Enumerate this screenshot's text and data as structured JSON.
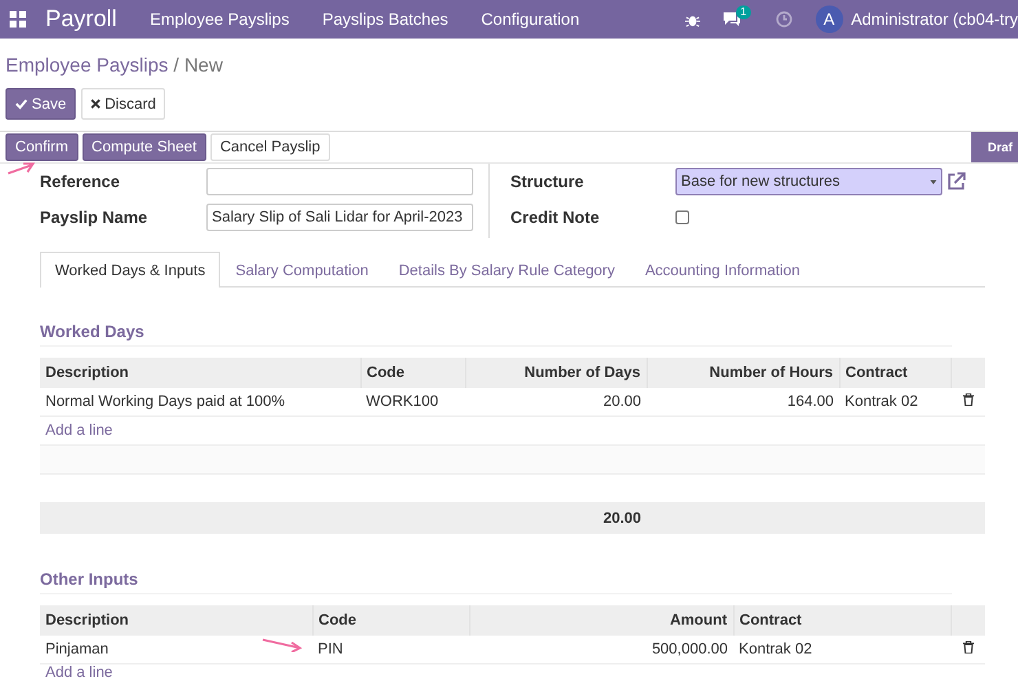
{
  "navbar": {
    "app_title": "Payroll",
    "menu": [
      "Employee Payslips",
      "Payslips Batches",
      "Configuration"
    ],
    "notification_count": "1",
    "user": {
      "initial": "A",
      "name": "Administrator (cb04-try"
    }
  },
  "breadcrumb": {
    "parent": "Employee Payslips",
    "separator": "/",
    "current": "New"
  },
  "buttons": [
    {
      "label": "Save",
      "kind": "primary"
    },
    {
      "label": "Discard",
      "kind": "secondary"
    }
  ],
  "actions": [
    {
      "label": "Confirm",
      "kind": "primary"
    },
    {
      "label": "Compute Sheet",
      "kind": "primary"
    },
    {
      "label": "Cancel Payslip",
      "kind": "secondary"
    }
  ],
  "status": "Draf",
  "fields_left": [
    {
      "label": "Reference"
    },
    {
      "label": "Payslip Name",
      "value": "Salary Slip of Sali Lidar for April-2023"
    }
  ],
  "fields_right": [
    {
      "label": "Structure",
      "kind": "select",
      "value": "Base for new structures"
    },
    {
      "label": "Credit Note",
      "kind": "checkbox",
      "checked": false
    }
  ],
  "tabs": [
    {
      "label": "Worked Days & Inputs",
      "selected": true
    },
    {
      "label": "Salary Computation",
      "selected": false
    },
    {
      "label": "Details By Salary Rule Category",
      "selected": false
    },
    {
      "label": "Accounting Information",
      "selected": false
    }
  ],
  "worked_days": {
    "title": "Worked Days",
    "columns": [
      {
        "label": "Description",
        "kind": "text"
      },
      {
        "label": "Code",
        "kind": "text"
      },
      {
        "label": "Number of Days",
        "kind": "number",
        "total": "20.00"
      },
      {
        "label": "Number of Hours",
        "kind": "number"
      },
      {
        "label": "Contract",
        "kind": "text"
      }
    ],
    "rows": [
      [
        "Normal Working Days paid at 100%",
        "WORK100",
        "20.00",
        "164.00",
        "Kontrak 02"
      ]
    ],
    "add_line": "Add a line"
  },
  "other_inputs": {
    "title": "Other Inputs",
    "columns": [
      {
        "label": "Description",
        "kind": "text"
      },
      {
        "label": "Code",
        "kind": "text"
      },
      {
        "label": "Amount",
        "kind": "number"
      },
      {
        "label": "Contract",
        "kind": "text"
      }
    ],
    "rows": [
      [
        "Pinjaman",
        "PIN",
        "500,000.00",
        "Kontrak 02"
      ]
    ],
    "add_line": "Add a line"
  }
}
